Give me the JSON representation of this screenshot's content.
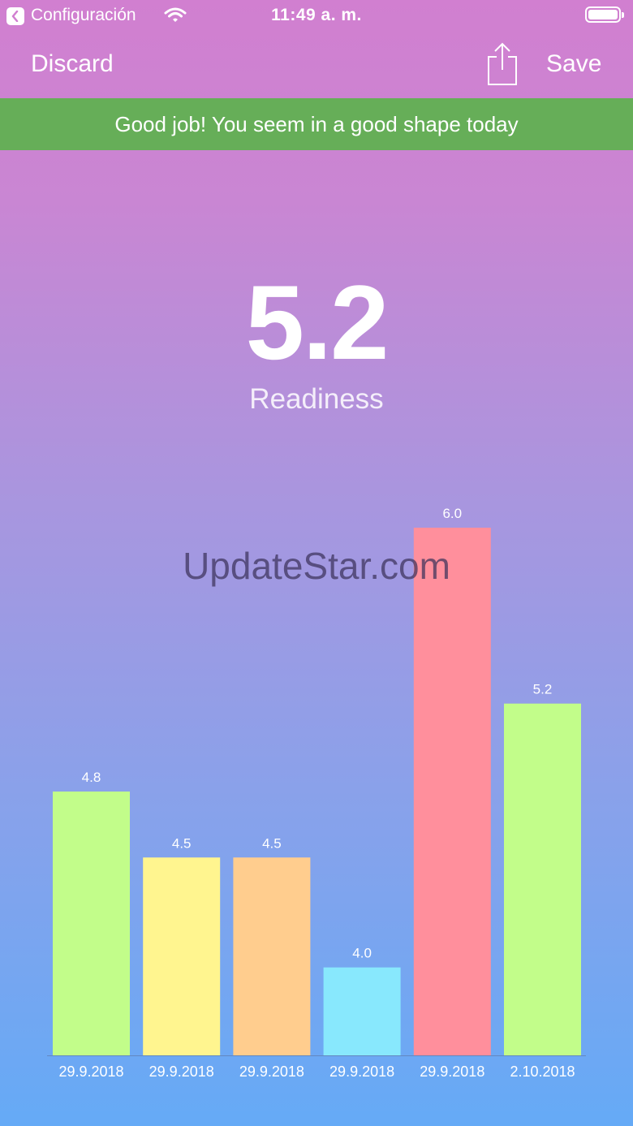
{
  "status_bar": {
    "back_app": "Configuración",
    "time": "11:49 a. m."
  },
  "nav": {
    "discard_label": "Discard",
    "save_label": "Save",
    "share_icon": "share-icon"
  },
  "banner": {
    "message": "Good job! You seem in a good shape today",
    "color": "#66ae58"
  },
  "readiness": {
    "score": "5.2",
    "label": "Readiness"
  },
  "watermark": "UpdateStar.com",
  "chart_data": {
    "type": "bar",
    "categories": [
      "29.9.2018",
      "29.9.2018",
      "29.9.2018",
      "29.9.2018",
      "29.9.2018",
      "2.10.2018"
    ],
    "values": [
      4.8,
      4.5,
      4.5,
      4.0,
      6.0,
      5.2
    ],
    "value_labels": [
      "4.8",
      "4.5",
      "4.5",
      "4.0",
      "6.0",
      "5.2"
    ],
    "colors": [
      "#c2fd8a",
      "#fff58f",
      "#ffcd8e",
      "#88e8fd",
      "#ff8f9c",
      "#c2fd8a"
    ],
    "ylim": [
      3.6,
      6.0
    ],
    "grid": false,
    "title": "",
    "xlabel": "",
    "ylabel": ""
  }
}
